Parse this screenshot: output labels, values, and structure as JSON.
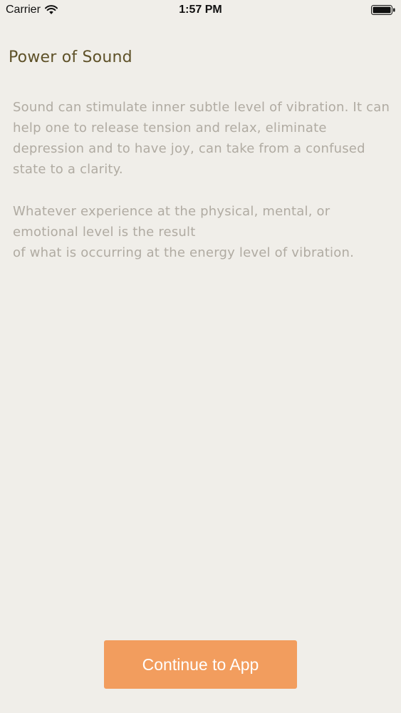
{
  "status_bar": {
    "carrier": "Carrier",
    "time": "1:57 PM",
    "icons": [
      "wifi-icon",
      "battery-icon"
    ]
  },
  "content": {
    "title": "Power of Sound",
    "paragraphs": [
      "Sound can stimulate inner subtle level of vibration. It can help one to release tension and relax, eliminate depression and to have joy, can take from a confused state to a clarity.",
      "Whatever experience at the physical, mental, or\nemotional level is the result\nof what is occurring at the energy level of vibration."
    ]
  },
  "actions": {
    "continue_label": "Continue to App"
  },
  "colors": {
    "background": "#f0eee9",
    "title": "#5e5128",
    "body_text": "#b0aba2",
    "button": "#f29d5e",
    "button_text": "#ffffff"
  }
}
